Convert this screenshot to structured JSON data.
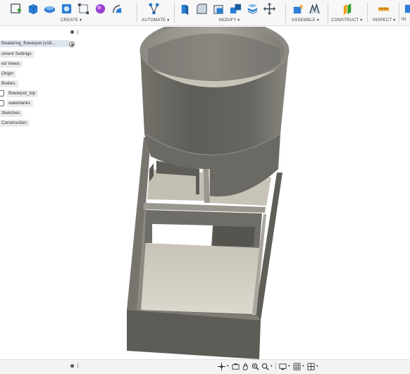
{
  "toolbar": {
    "groups": [
      {
        "label": "CREATE ▾",
        "icons": [
          "sketch-icon",
          "box-icon",
          "sweep-icon",
          "hole-icon",
          "rectangle-icon",
          "form-icon",
          "revolve-icon"
        ]
      },
      {
        "label": "AUTOMATE ▾",
        "icons": [
          "automate-icon"
        ]
      },
      {
        "label": "MODIFY ▾",
        "icons": [
          "press-pull-icon",
          "fillet-icon",
          "shell-icon",
          "combine-icon",
          "split-icon",
          "move-icon"
        ]
      },
      {
        "label": "ASSEMBLE ▾",
        "icons": [
          "new-component-icon",
          "joint-icon"
        ]
      },
      {
        "label": "CONSTRUCT ▾",
        "icons": [
          "offset-plane-icon"
        ]
      },
      {
        "label": "INSPECT ▾",
        "icons": [
          "measure-icon"
        ]
      },
      {
        "label": "IN",
        "icons": [
          "insert-icon"
        ]
      }
    ]
  },
  "browser": {
    "file_name": "ftwatering_flowerpot (v18...",
    "items": [
      {
        "label": "ument Settings"
      },
      {
        "label": "ed Views"
      },
      {
        "label": "Origin"
      },
      {
        "label": "Bodies"
      },
      {
        "label": "flowerpot_top"
      },
      {
        "label": "watertanks"
      },
      {
        "label": "Sketches"
      },
      {
        "label": "Construction"
      }
    ]
  },
  "colors": {
    "toolbar_bg": "#f7f7f7",
    "model_body": "#6b6a64",
    "model_floor": "#d8d3c8",
    "accent_blue": "#2a7fd4"
  },
  "nav_bar": {
    "tools": [
      "orbit-icon",
      "look-at-icon",
      "pan-icon",
      "zoom-icon",
      "fit-icon",
      "display-settings-icon",
      "grid-icon",
      "viewports-icon"
    ]
  }
}
